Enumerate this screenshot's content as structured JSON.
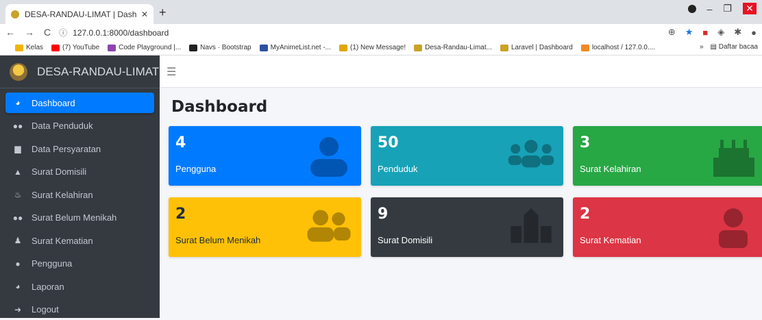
{
  "browser": {
    "tab_title": "DESA-RANDAU-LIMAT | Dashboa",
    "tab_close": "✕",
    "new_tab": "+",
    "url": "127.0.0.1:8000/dashboard",
    "bookmarks": [
      {
        "label": "Kelas",
        "color": "#f2b400"
      },
      {
        "label": "(7) YouTube",
        "color": "#ff0000"
      },
      {
        "label": "Code Playground |...",
        "color": "#8e44ad"
      },
      {
        "label": "Navs · Bootstrap",
        "color": "#222222"
      },
      {
        "label": "MyAnimeList.net -...",
        "color": "#2e51a2"
      },
      {
        "label": "(1) New Message!",
        "color": "#e0a800"
      },
      {
        "label": "Desa-Randau-Limat...",
        "color": "#c9a227"
      },
      {
        "label": "Laravel | Dashboard",
        "color": "#c9a227"
      },
      {
        "label": "localhost / 127.0.0....",
        "color": "#f08a24"
      }
    ],
    "bookmarks_more": "»",
    "reading_list": "Daftar bacaa"
  },
  "brand": {
    "name": "DESA-RANDAU-LIMAT"
  },
  "sidebar": {
    "items": [
      {
        "label": "Dashboard",
        "icon": "tachometer-icon",
        "active": true
      },
      {
        "label": "Data Penduduk",
        "icon": "users-icon"
      },
      {
        "label": "Data Persyaratan",
        "icon": "file-icon"
      },
      {
        "label": "Surat Domisili",
        "icon": "place-of-worship-icon"
      },
      {
        "label": "Surat Kelahiran",
        "icon": "birthday-cake-icon"
      },
      {
        "label": "Surat Belum Menikah",
        "icon": "user-friends-icon"
      },
      {
        "label": "Surat Kematian",
        "icon": "user-injured-icon"
      },
      {
        "label": "Pengguna",
        "icon": "user-icon"
      },
      {
        "label": "Laporan",
        "icon": "tachometer-icon"
      },
      {
        "label": "Logout",
        "icon": "sign-out-icon"
      }
    ]
  },
  "page": {
    "title": "Dashboard"
  },
  "cards": [
    {
      "value": "4",
      "label": "Pengguna",
      "color": "#007bff",
      "icon": "user-icon"
    },
    {
      "value": "50",
      "label": "Penduduk",
      "color": "#17a2b8",
      "icon": "users-icon"
    },
    {
      "value": "3",
      "label": "Surat Kelahiran",
      "color": "#28a745",
      "icon": "birthday-cake-icon"
    },
    {
      "value": "2",
      "label": "Surat Belum Menikah",
      "color": "#ffc107",
      "icon": "user-friends-icon"
    },
    {
      "value": "9",
      "label": "Surat Domisili",
      "color": "#343a40",
      "icon": "place-of-worship-icon"
    },
    {
      "value": "2",
      "label": "Surat Kematian",
      "color": "#dc3545",
      "icon": "user-injured-icon"
    }
  ]
}
